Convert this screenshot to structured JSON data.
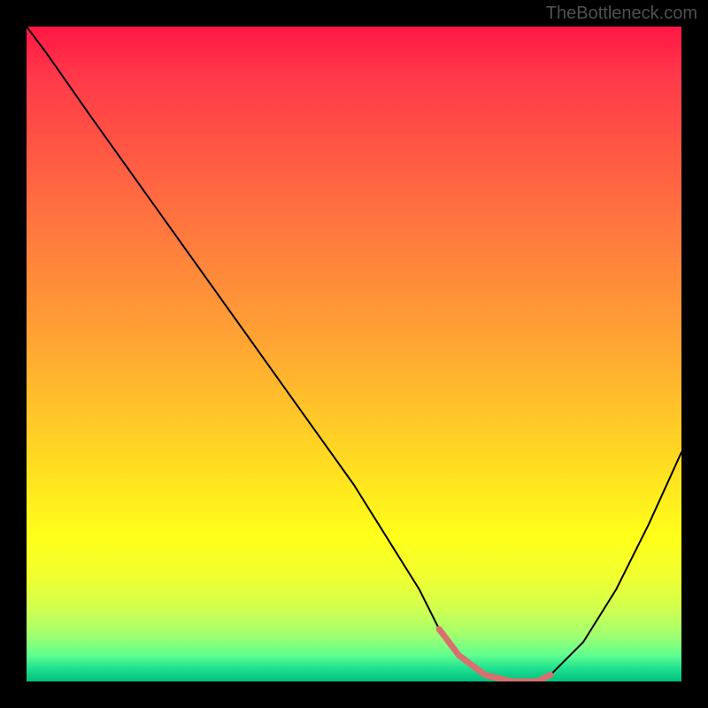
{
  "watermark": "TheBottleneck.com",
  "chart_data": {
    "type": "line",
    "title": "",
    "xlabel": "",
    "ylabel": "",
    "xlim": [
      0,
      100
    ],
    "ylim": [
      0,
      100
    ],
    "series": [
      {
        "name": "bottleneck-curve",
        "color": "#000000",
        "x": [
          0,
          3,
          10,
          20,
          30,
          40,
          50,
          55,
          60,
          63,
          66,
          70,
          74,
          78,
          80,
          85,
          90,
          95,
          100
        ],
        "values": [
          100,
          96,
          86,
          72,
          58,
          44,
          30,
          22,
          14,
          8,
          4,
          1,
          0,
          0,
          1,
          6,
          14,
          24,
          35
        ]
      },
      {
        "name": "optimal-range-marker",
        "color": "#e57373",
        "x": [
          63,
          66,
          70,
          74,
          78,
          80
        ],
        "values": [
          8,
          4,
          1,
          0,
          0,
          1
        ]
      }
    ],
    "gradient_stops": [
      {
        "pos": 0,
        "color": "#ff1744"
      },
      {
        "pos": 50,
        "color": "#ffb030"
      },
      {
        "pos": 80,
        "color": "#ffff20"
      },
      {
        "pos": 100,
        "color": "#00c080"
      }
    ]
  }
}
